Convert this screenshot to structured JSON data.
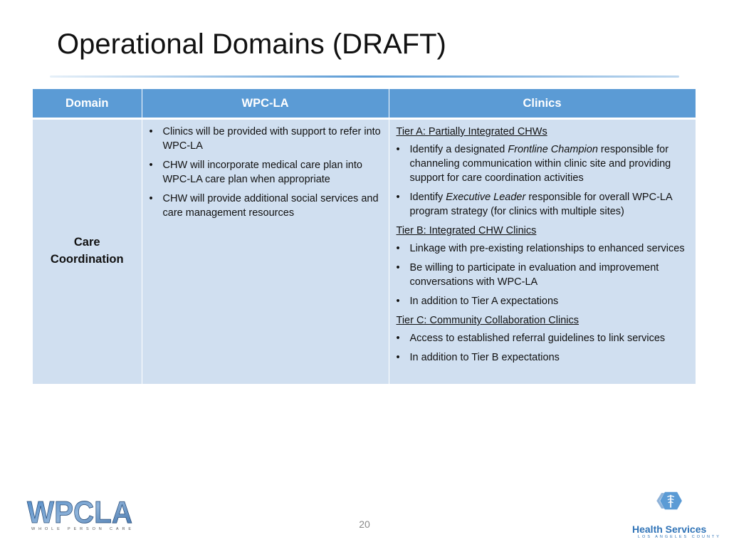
{
  "slide": {
    "title": "Operational Domains (DRAFT)",
    "page_number": "20"
  },
  "table": {
    "headers": [
      "Domain",
      "WPC-LA",
      "Clinics"
    ],
    "domain": "Care Coordination",
    "wpc_items": [
      "Clinics will be provided with support to refer into WPC-LA",
      "CHW will incorporate medical care plan into WPC-LA care plan when appropriate",
      "CHW will provide additional social services and care management resources"
    ],
    "clinics": {
      "tier_a": {
        "heading": "Tier A: Partially Integrated CHWs",
        "item1_pre": "Identify a designated ",
        "item1_em": "Frontline Champion",
        "item1_post": " responsible for channeling communication within clinic site and providing support for care coordination activities",
        "item2_pre": "Identify ",
        "item2_em": "Executive Leader",
        "item2_post": " responsible for overall WPC-LA program strategy (for clinics with multiple sites)"
      },
      "tier_b": {
        "heading": "Tier B: Integrated CHW Clinics",
        "items": [
          "Linkage with pre-existing relationships to enhanced services",
          "Be willing to participate in evaluation and improvement conversations with WPC-LA",
          "In addition to Tier A expectations"
        ]
      },
      "tier_c": {
        "heading": "Tier C: Community Collaboration Clinics",
        "items": [
          "Access to established referral guidelines to link services",
          "In addition to Tier B expectations"
        ]
      }
    }
  },
  "logos": {
    "wpcla_text": "WPCLA",
    "wpcla_sub": "WHOLE PERSON CARE",
    "hs_text": "Health Services",
    "hs_sub": "LOS ANGELES COUNTY"
  },
  "colors": {
    "header_blue": "#5b9bd5",
    "cell_blue": "#d0dff0",
    "hs_blue": "#2f73b7"
  }
}
